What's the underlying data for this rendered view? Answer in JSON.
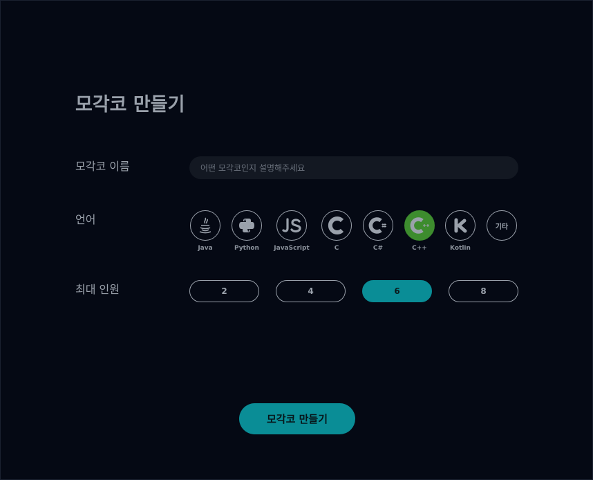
{
  "title": "모각코 만들기",
  "form": {
    "name_label": "모각코 이름",
    "name_placeholder": "어떤 모각코인지 설명해주세요",
    "name_value": "",
    "language_label": "언어",
    "capacity_label": "최대 인원"
  },
  "languages": [
    {
      "label": "Java",
      "icon": "java-icon",
      "selected": false
    },
    {
      "label": "Python",
      "icon": "python-icon",
      "selected": false
    },
    {
      "label": "JavaScript",
      "icon": "javascript-icon",
      "selected": false
    },
    {
      "label": "C",
      "icon": "c-icon",
      "selected": false
    },
    {
      "label": "C#",
      "icon": "csharp-icon",
      "selected": false
    },
    {
      "label": "C++",
      "icon": "cplusplus-icon",
      "selected": true
    },
    {
      "label": "Kotlin",
      "icon": "kotlin-icon",
      "selected": false
    },
    {
      "label": "기타",
      "icon": "etc-text",
      "selected": false
    }
  ],
  "capacity_options": [
    {
      "label": "2",
      "selected": false
    },
    {
      "label": "4",
      "selected": false
    },
    {
      "label": "6",
      "selected": true
    },
    {
      "label": "8",
      "selected": false
    }
  ],
  "submit_label": "모각코 만들기",
  "colors": {
    "background": "#050914",
    "accent": "#0a8d96",
    "selected_language": "#3d8c2e",
    "text": "#9aa1ab",
    "input_bg": "#131822"
  }
}
